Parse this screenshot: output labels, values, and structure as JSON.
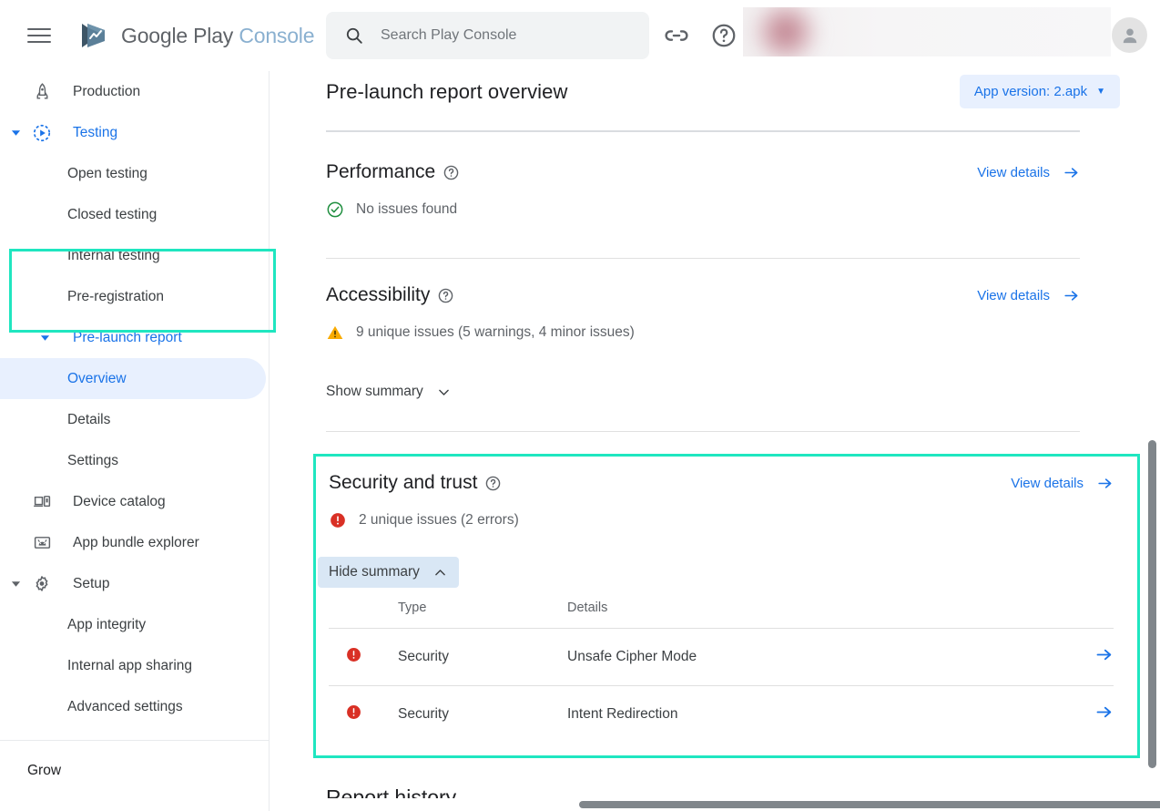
{
  "topbar": {
    "menu_icon": "hamburger-icon",
    "brand_primary": "Google Play",
    "brand_secondary": "Console",
    "search_placeholder": "Search Play Console",
    "search_value": "",
    "link_icon": "link-icon",
    "help_icon": "help-circle-icon",
    "avatar_icon": "account-avatar-icon"
  },
  "sidebar": {
    "items": [
      {
        "label": "Production",
        "icon": "rocket-icon",
        "type": "parent",
        "expandable": false,
        "active": false
      },
      {
        "label": "Testing",
        "icon": "play-circle-icon",
        "type": "parent",
        "expandable": true,
        "expanded": true,
        "active": true
      },
      {
        "label": "Open testing",
        "type": "child"
      },
      {
        "label": "Closed testing",
        "type": "child"
      },
      {
        "label": "Internal testing",
        "type": "child"
      },
      {
        "label": "Pre-registration",
        "type": "child"
      },
      {
        "label": "Pre-launch report",
        "type": "parent-noicon",
        "expandable": true,
        "expanded": true,
        "active": true
      },
      {
        "label": "Overview",
        "type": "child",
        "selected": true
      },
      {
        "label": "Details",
        "type": "child"
      },
      {
        "label": "Settings",
        "type": "child"
      },
      {
        "label": "Device catalog",
        "icon": "devices-icon",
        "type": "parent",
        "expandable": false
      },
      {
        "label": "App bundle explorer",
        "icon": "android-box-icon",
        "type": "parent",
        "expandable": false
      },
      {
        "label": "Setup",
        "icon": "gear-icon",
        "type": "parent",
        "expandable": true,
        "expanded": true
      },
      {
        "label": "App integrity",
        "type": "child"
      },
      {
        "label": "Internal app sharing",
        "type": "child"
      },
      {
        "label": "Advanced settings",
        "type": "child"
      }
    ],
    "footer_label": "Grow"
  },
  "page": {
    "title": "Pre-launch report overview",
    "version_button": "App version: 2.apk",
    "version_caret": "chevron-down-icon"
  },
  "sections": [
    {
      "title": "Performance",
      "help_icon": "help-circle-icon",
      "view_details": "View details",
      "status_icon": "check-circle-icon",
      "status_color": "#1e8e3e",
      "status_text": "No issues found"
    },
    {
      "title": "Accessibility",
      "help_icon": "help-circle-icon",
      "view_details": "View details",
      "status_icon": "warning-triangle-icon",
      "status_color": "#f9ab00",
      "status_text": "9 unique issues (5 warnings, 4 minor issues)",
      "summary_toggle": "Show summary",
      "summary_caret": "chevron-down-icon",
      "summary_open": false
    },
    {
      "title": "Security and trust",
      "help_icon": "help-circle-icon",
      "view_details": "View details",
      "status_icon": "error-circle-icon",
      "status_color": "#d93025",
      "status_text": "2 unique issues (2 errors)",
      "summary_toggle": "Hide summary",
      "summary_caret": "chevron-up-icon",
      "summary_open": true,
      "highlighted": true,
      "table": {
        "headers": [
          "",
          "Type",
          "Details",
          ""
        ],
        "rows": [
          {
            "icon": "error-circle-icon",
            "type": "Security",
            "details": "Unsafe Cipher Mode",
            "arrow": "arrow-right-icon"
          },
          {
            "icon": "error-circle-icon",
            "type": "Security",
            "details": "Intent Redirection",
            "arrow": "arrow-right-icon"
          }
        ]
      }
    }
  ],
  "report_history": {
    "title": "Report history"
  },
  "colors": {
    "accent_blue": "#1a73e8",
    "highlight_teal": "#1fe6c0",
    "error_red": "#d93025",
    "warning_yellow": "#f9ab00",
    "success_green": "#1e8e3e",
    "chip_bg": "#e8f0fe"
  }
}
